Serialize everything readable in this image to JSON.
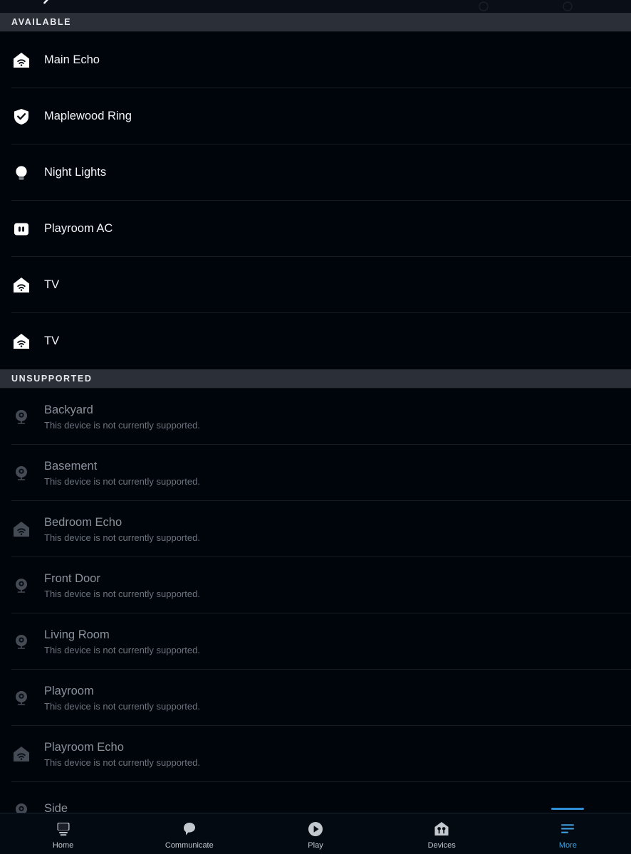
{
  "app": {
    "background_color": "#00050c",
    "section_header_bg": "#2b2f37",
    "accent_color": "#2f8fd6",
    "divider_color": "#171c25"
  },
  "topbar": {
    "back_icon": "chevron-left-icon"
  },
  "sections": [
    {
      "id": "available",
      "title": "AVAILABLE",
      "items": [
        {
          "name": "Main Echo",
          "icon": "echo-house-wifi-icon"
        },
        {
          "name": "Maplewood Ring",
          "icon": "shield-check-icon"
        },
        {
          "name": "Night Lights",
          "icon": "light-bulb-icon"
        },
        {
          "name": "Playroom AC",
          "icon": "power-outlet-icon"
        },
        {
          "name": "TV",
          "icon": "echo-house-wifi-icon"
        },
        {
          "name": "TV",
          "icon": "echo-house-wifi-icon"
        }
      ]
    },
    {
      "id": "unsupported",
      "title": "UNSUPPORTED",
      "items": [
        {
          "name": "Backyard",
          "status": "This device is not currently supported.",
          "icon": "camera-icon"
        },
        {
          "name": "Basement",
          "status": "This device is not currently supported.",
          "icon": "camera-icon"
        },
        {
          "name": "Bedroom Echo",
          "status": "This device is not currently supported.",
          "icon": "echo-house-wifi-icon"
        },
        {
          "name": "Front Door",
          "status": "This device is not currently supported.",
          "icon": "camera-icon"
        },
        {
          "name": "Living Room",
          "status": "This device is not currently supported.",
          "icon": "camera-icon"
        },
        {
          "name": "Playroom",
          "status": "This device is not currently supported.",
          "icon": "camera-icon"
        },
        {
          "name": "Playroom Echo",
          "status": "This device is not currently supported.",
          "icon": "echo-house-wifi-icon"
        },
        {
          "name": "Side",
          "status": "",
          "icon": "camera-icon"
        }
      ]
    }
  ],
  "bottom_nav": {
    "items": [
      {
        "label": "Home",
        "icon": "echo-device-icon",
        "active": false
      },
      {
        "label": "Communicate",
        "icon": "speech-bubble-icon",
        "active": false
      },
      {
        "label": "Play",
        "icon": "play-circle-icon",
        "active": false
      },
      {
        "label": "Devices",
        "icon": "devices-house-icon",
        "active": false
      },
      {
        "label": "More",
        "icon": "hamburger-menu-icon",
        "active": true
      }
    ]
  }
}
